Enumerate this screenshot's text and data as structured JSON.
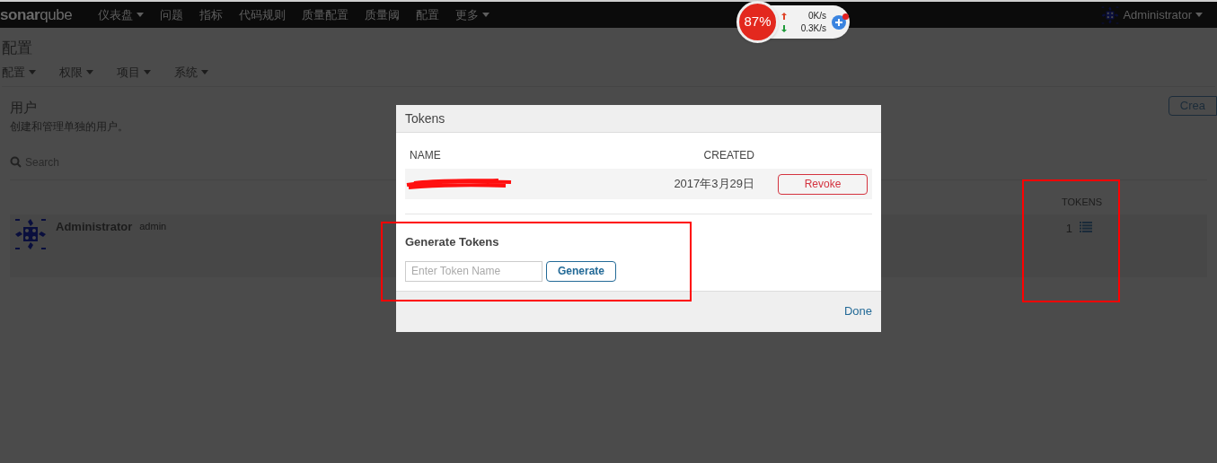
{
  "nav": {
    "logo": {
      "part1": "sonar",
      "part2": "qube"
    },
    "items": [
      {
        "label": "仪表盘",
        "dropdown": true
      },
      {
        "label": "问题",
        "dropdown": false
      },
      {
        "label": "指标",
        "dropdown": false
      },
      {
        "label": "代码规则",
        "dropdown": false
      },
      {
        "label": "质量配置",
        "dropdown": false
      },
      {
        "label": "质量阈",
        "dropdown": false
      },
      {
        "label": "配置",
        "dropdown": false
      },
      {
        "label": "更多",
        "dropdown": true
      }
    ],
    "user": "Administrator"
  },
  "net_widget": {
    "percent": "87%",
    "up": "0K/s",
    "down": "0.3K/s"
  },
  "page": {
    "title": "配置",
    "menu": [
      {
        "label": "配置"
      },
      {
        "label": "权限"
      },
      {
        "label": "项目"
      },
      {
        "label": "系统"
      }
    ],
    "section_title": "用户",
    "section_desc": "创建和管理单独的用户。",
    "create_button": "Crea",
    "search": {
      "placeholder": "Search"
    },
    "tokens_header": "TOKENS",
    "users": [
      {
        "name": "Administrator",
        "login": "admin",
        "tokens": "1"
      }
    ]
  },
  "modal": {
    "title": "Tokens",
    "columns": [
      "NAME",
      "CREATED"
    ],
    "tokens": [
      {
        "created": "2017年3月29日",
        "action": "Revoke"
      }
    ],
    "generate_title": "Generate Tokens",
    "input": {
      "placeholder": "Enter Token Name"
    },
    "generate_button": "Generate",
    "done": "Done"
  }
}
